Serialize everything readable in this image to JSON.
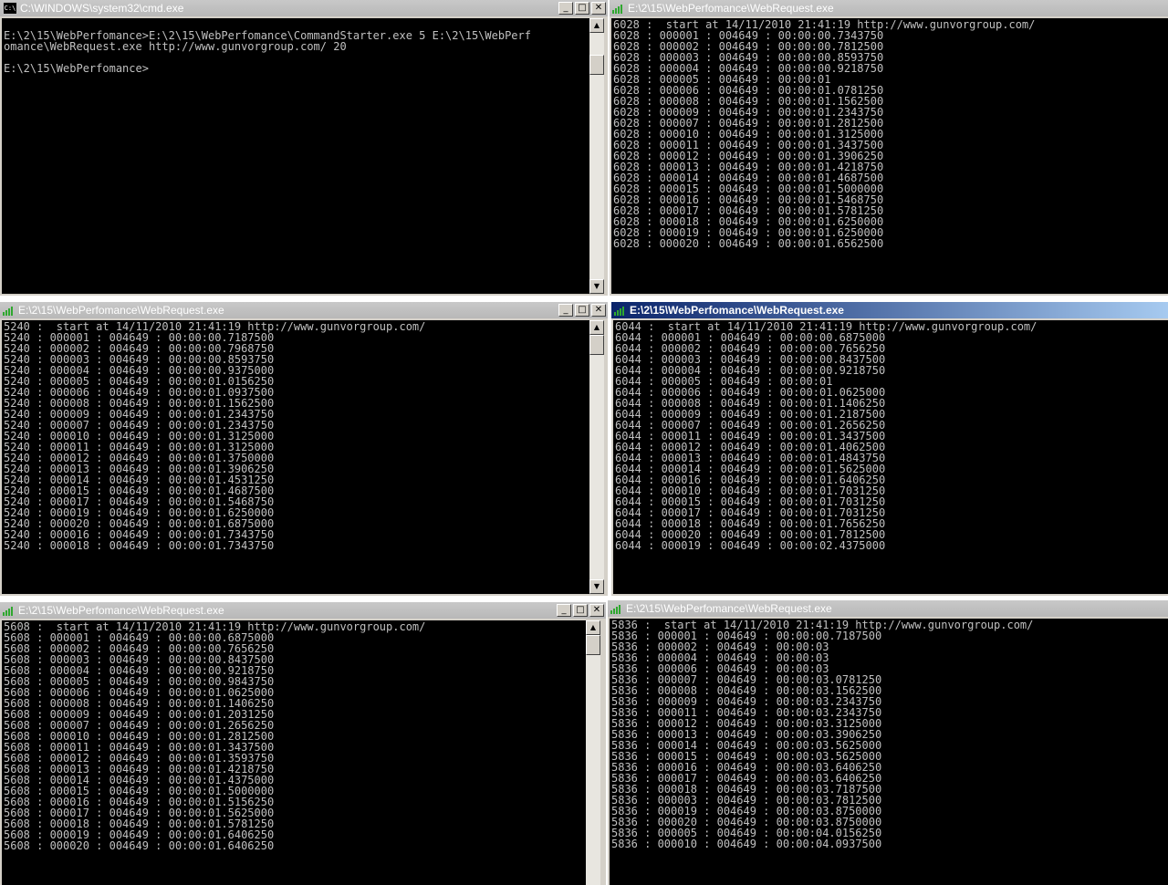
{
  "windows": [
    {
      "title": "C:\\WINDOWS\\system32\\cmd.exe",
      "lines": [
        "",
        "E:\\2\\15\\WebPerfomance>E:\\2\\15\\WebPerfomance\\CommandStarter.exe 5 E:\\2\\15\\WebPerf",
        "omance\\WebRequest.exe http://www.gunvorgroup.com/ 20",
        "",
        "E:\\2\\15\\WebPerfomance>"
      ]
    },
    {
      "title": "E:\\2\\15\\WebPerfomance\\WebRequest.exe",
      "lines": [
        "6028 :  start at 14/11/2010 21:41:19 http://www.gunvorgroup.com/",
        "6028 : 000001 : 004649 : 00:00:00.7343750",
        "6028 : 000002 : 004649 : 00:00:00.7812500",
        "6028 : 000003 : 004649 : 00:00:00.8593750",
        "6028 : 000004 : 004649 : 00:00:00.9218750",
        "6028 : 000005 : 004649 : 00:00:01",
        "6028 : 000006 : 004649 : 00:00:01.0781250",
        "6028 : 000008 : 004649 : 00:00:01.1562500",
        "6028 : 000009 : 004649 : 00:00:01.2343750",
        "6028 : 000007 : 004649 : 00:00:01.2812500",
        "6028 : 000010 : 004649 : 00:00:01.3125000",
        "6028 : 000011 : 004649 : 00:00:01.3437500",
        "6028 : 000012 : 004649 : 00:00:01.3906250",
        "6028 : 000013 : 004649 : 00:00:01.4218750",
        "6028 : 000014 : 004649 : 00:00:01.4687500",
        "6028 : 000015 : 004649 : 00:00:01.5000000",
        "6028 : 000016 : 004649 : 00:00:01.5468750",
        "6028 : 000017 : 004649 : 00:00:01.5781250",
        "6028 : 000018 : 004649 : 00:00:01.6250000",
        "6028 : 000019 : 004649 : 00:00:01.6250000",
        "6028 : 000020 : 004649 : 00:00:01.6562500"
      ]
    },
    {
      "title": "E:\\2\\15\\WebPerfomance\\WebRequest.exe",
      "lines": [
        "5240 :  start at 14/11/2010 21:41:19 http://www.gunvorgroup.com/",
        "5240 : 000001 : 004649 : 00:00:00.7187500",
        "5240 : 000002 : 004649 : 00:00:00.7968750",
        "5240 : 000003 : 004649 : 00:00:00.8593750",
        "5240 : 000004 : 004649 : 00:00:00.9375000",
        "5240 : 000005 : 004649 : 00:00:01.0156250",
        "5240 : 000006 : 004649 : 00:00:01.0937500",
        "5240 : 000008 : 004649 : 00:00:01.1562500",
        "5240 : 000009 : 004649 : 00:00:01.2343750",
        "5240 : 000007 : 004649 : 00:00:01.2343750",
        "5240 : 000010 : 004649 : 00:00:01.3125000",
        "5240 : 000011 : 004649 : 00:00:01.3125000",
        "5240 : 000012 : 004649 : 00:00:01.3750000",
        "5240 : 000013 : 004649 : 00:00:01.3906250",
        "5240 : 000014 : 004649 : 00:00:01.4531250",
        "5240 : 000015 : 004649 : 00:00:01.4687500",
        "5240 : 000017 : 004649 : 00:00:01.5468750",
        "5240 : 000019 : 004649 : 00:00:01.6250000",
        "5240 : 000020 : 004649 : 00:00:01.6875000",
        "5240 : 000016 : 004649 : 00:00:01.7343750",
        "5240 : 000018 : 004649 : 00:00:01.7343750"
      ]
    },
    {
      "title": "E:\\2\\15\\WebPerfomance\\WebRequest.exe",
      "lines": [
        "6044 :  start at 14/11/2010 21:41:19 http://www.gunvorgroup.com/",
        "6044 : 000001 : 004649 : 00:00:00.6875000",
        "6044 : 000002 : 004649 : 00:00:00.7656250",
        "6044 : 000003 : 004649 : 00:00:00.8437500",
        "6044 : 000004 : 004649 : 00:00:00.9218750",
        "6044 : 000005 : 004649 : 00:00:01",
        "6044 : 000006 : 004649 : 00:00:01.0625000",
        "6044 : 000008 : 004649 : 00:00:01.1406250",
        "6044 : 000009 : 004649 : 00:00:01.2187500",
        "6044 : 000007 : 004649 : 00:00:01.2656250",
        "6044 : 000011 : 004649 : 00:00:01.3437500",
        "6044 : 000012 : 004649 : 00:00:01.4062500",
        "6044 : 000013 : 004649 : 00:00:01.4843750",
        "6044 : 000014 : 004649 : 00:00:01.5625000",
        "6044 : 000016 : 004649 : 00:00:01.6406250",
        "6044 : 000010 : 004649 : 00:00:01.7031250",
        "6044 : 000015 : 004649 : 00:00:01.7031250",
        "6044 : 000017 : 004649 : 00:00:01.7031250",
        "6044 : 000018 : 004649 : 00:00:01.7656250",
        "6044 : 000020 : 004649 : 00:00:01.7812500",
        "6044 : 000019 : 004649 : 00:00:02.4375000"
      ]
    },
    {
      "title": "E:\\2\\15\\WebPerfomance\\WebRequest.exe",
      "lines": [
        "5608 :  start at 14/11/2010 21:41:19 http://www.gunvorgroup.com/",
        "5608 : 000001 : 004649 : 00:00:00.6875000",
        "5608 : 000002 : 004649 : 00:00:00.7656250",
        "5608 : 000003 : 004649 : 00:00:00.8437500",
        "5608 : 000004 : 004649 : 00:00:00.9218750",
        "5608 : 000005 : 004649 : 00:00:00.9843750",
        "5608 : 000006 : 004649 : 00:00:01.0625000",
        "5608 : 000008 : 004649 : 00:00:01.1406250",
        "5608 : 000009 : 004649 : 00:00:01.2031250",
        "5608 : 000007 : 004649 : 00:00:01.2656250",
        "5608 : 000010 : 004649 : 00:00:01.2812500",
        "5608 : 000011 : 004649 : 00:00:01.3437500",
        "5608 : 000012 : 004649 : 00:00:01.3593750",
        "5608 : 000013 : 004649 : 00:00:01.4218750",
        "5608 : 000014 : 004649 : 00:00:01.4375000",
        "5608 : 000015 : 004649 : 00:00:01.5000000",
        "5608 : 000016 : 004649 : 00:00:01.5156250",
        "5608 : 000017 : 004649 : 00:00:01.5625000",
        "5608 : 000018 : 004649 : 00:00:01.5781250",
        "5608 : 000019 : 004649 : 00:00:01.6406250",
        "5608 : 000020 : 004649 : 00:00:01.6406250"
      ]
    },
    {
      "title": "E:\\2\\15\\WebPerfomance\\WebRequest.exe",
      "lines": [
        "5836 :  start at 14/11/2010 21:41:19 http://www.gunvorgroup.com/",
        "5836 : 000001 : 004649 : 00:00:00.7187500",
        "5836 : 000002 : 004649 : 00:00:03",
        "5836 : 000004 : 004649 : 00:00:03",
        "5836 : 000006 : 004649 : 00:00:03",
        "5836 : 000007 : 004649 : 00:00:03.0781250",
        "5836 : 000008 : 004649 : 00:00:03.1562500",
        "5836 : 000009 : 004649 : 00:00:03.2343750",
        "5836 : 000011 : 004649 : 00:00:03.2343750",
        "5836 : 000012 : 004649 : 00:00:03.3125000",
        "5836 : 000013 : 004649 : 00:00:03.3906250",
        "5836 : 000014 : 004649 : 00:00:03.5625000",
        "5836 : 000015 : 004649 : 00:00:03.5625000",
        "5836 : 000016 : 004649 : 00:00:03.6406250",
        "5836 : 000017 : 004649 : 00:00:03.6406250",
        "5836 : 000018 : 004649 : 00:00:03.7187500",
        "5836 : 000003 : 004649 : 00:00:03.7812500",
        "5836 : 000019 : 004649 : 00:00:03.8750000",
        "5836 : 000020 : 004649 : 00:00:03.8750000",
        "5836 : 000005 : 004649 : 00:00:04.0156250",
        "5836 : 000010 : 004649 : 00:00:04.0937500"
      ]
    }
  ],
  "icons": {
    "cmd": "cmd-app-icon",
    "webrequest": "signal-bars-icon",
    "minimize": "minimize-icon",
    "maximize": "maximize-icon",
    "close": "close-icon"
  },
  "colors": {
    "console_bg": "#000000",
    "console_text": "#c0c0c0",
    "active_title": "#0a246a",
    "inactive_title": "#b8b8b8"
  }
}
